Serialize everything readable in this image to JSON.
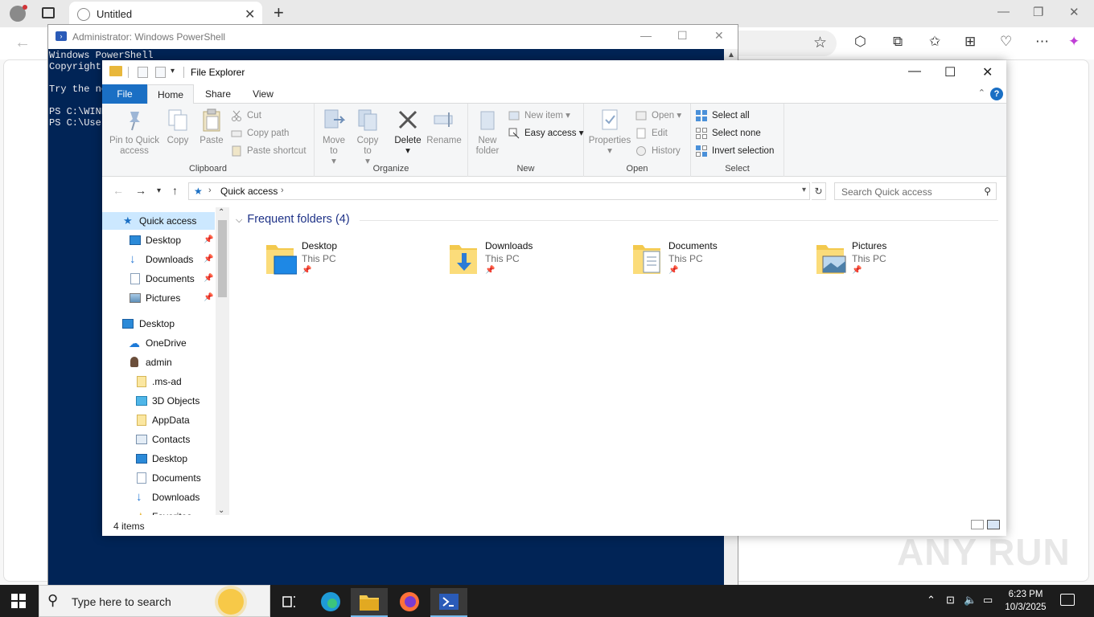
{
  "browser": {
    "tab_title": "Untitled",
    "new_tab": "+",
    "tab_close": "✕",
    "minimize": "—",
    "restore": "❐",
    "close": "✕",
    "back": "←",
    "star": "☆",
    "toolbar_icons": [
      "extensions-icon",
      "split-screen-icon",
      "favorites-icon",
      "collections-icon",
      "browser-essentials-icon",
      "more-icon",
      "copilot-icon"
    ],
    "toolbar_glyphs": [
      "⬡",
      "⧉",
      "✩",
      "⊞",
      "♡",
      "⋯",
      "✦"
    ]
  },
  "powershell": {
    "title": "Administrator: Windows PowerShell",
    "lines": [
      "Windows PowerShell",
      "Copyright",
      "",
      "Try the ne",
      "",
      "PS C:\\WIND",
      "PS C:\\User"
    ],
    "minimize": "—",
    "maximize": "☐",
    "close": "✕"
  },
  "explorer": {
    "title": "File Explorer",
    "minimize": "—",
    "maximize": "☐",
    "close": "✕",
    "tabs": {
      "file": "File",
      "home": "Home",
      "share": "Share",
      "view": "View"
    },
    "help": "?",
    "ribbon": {
      "clipboard": {
        "label": "Clipboard",
        "pin": "Pin to Quick access",
        "copy": "Copy",
        "paste": "Paste",
        "cut": "Cut",
        "copy_path": "Copy path",
        "paste_shortcut": "Paste shortcut"
      },
      "organize": {
        "label": "Organize",
        "move_to": "Move to",
        "copy_to": "Copy to",
        "delete": "Delete",
        "rename": "Rename"
      },
      "new": {
        "label": "New",
        "new_folder": "New folder",
        "new_item": "New item",
        "easy_access": "Easy access"
      },
      "open": {
        "label": "Open",
        "properties": "Properties",
        "open": "Open",
        "edit": "Edit",
        "history": "History"
      },
      "select": {
        "label": "Select",
        "select_all": "Select all",
        "select_none": "Select none",
        "invert": "Invert selection"
      }
    },
    "address": {
      "crumb": "Quick access"
    },
    "search_placeholder": "Search Quick access",
    "nav": {
      "quick_access": "Quick access",
      "pinned": [
        "Desktop",
        "Downloads",
        "Documents",
        "Pictures"
      ],
      "desktop": "Desktop",
      "onedrive": "OneDrive",
      "admin": "admin",
      "admin_children": [
        ".ms-ad",
        "3D Objects",
        "AppData",
        "Contacts",
        "Desktop",
        "Documents",
        "Downloads",
        "Favorites"
      ]
    },
    "group_header": "Frequent folders (4)",
    "folders": [
      {
        "name": "Desktop",
        "location": "This PC"
      },
      {
        "name": "Downloads",
        "location": "This PC"
      },
      {
        "name": "Documents",
        "location": "This PC"
      },
      {
        "name": "Pictures",
        "location": "This PC"
      }
    ],
    "status": "4 items"
  },
  "watermark": "ANY RUN",
  "taskbar": {
    "search_placeholder": "Type here to search",
    "time": "6:23 PM",
    "date": "10/3/2025",
    "tray_glyphs": [
      "⌃",
      "⊡",
      "🔈",
      "▭"
    ]
  },
  "colors": {
    "accent": "#1a6fc4",
    "powershell_bg": "#012456",
    "taskbar_bg": "#1c1c1c",
    "folder_yellow": "#e8b73b",
    "selection": "#cce8ff"
  }
}
